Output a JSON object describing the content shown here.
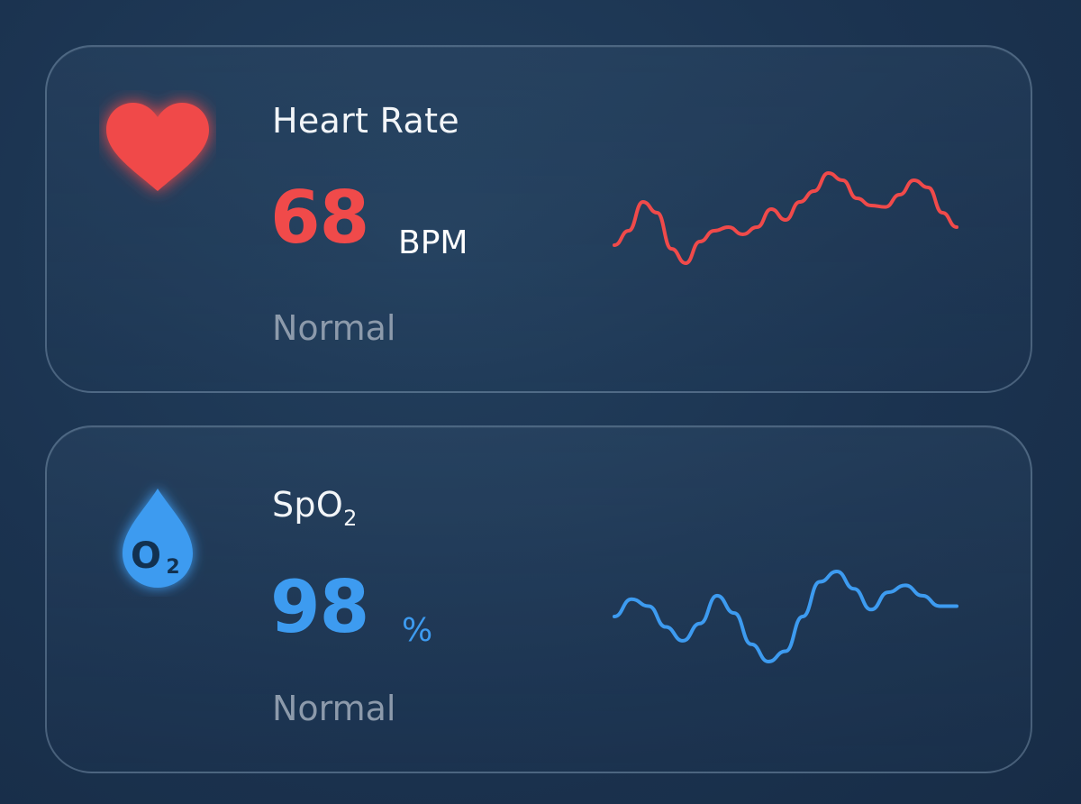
{
  "colors": {
    "heart_accent": "#f04a4a",
    "spo2_accent": "#3d9bf0",
    "status_text": "#8c9aab",
    "title_text": "#f2f5f8"
  },
  "metrics": [
    {
      "id": "heart",
      "icon": "heart-icon",
      "title": "Heart Rate",
      "value": "68",
      "unit": "BPM",
      "status": "Normal",
      "trend": [
        0.35,
        0.55,
        0.95,
        0.8,
        0.3,
        0.1,
        0.4,
        0.55,
        0.6,
        0.5,
        0.6,
        0.85,
        0.7,
        0.95,
        1.1,
        1.35,
        1.25,
        1.0,
        0.9,
        0.88,
        1.05,
        1.25,
        1.15,
        0.8,
        0.6
      ]
    },
    {
      "id": "spo2",
      "icon": "oxygen-drop-icon",
      "title_main": "SpO",
      "title_sub": "2",
      "icon_label_main": "O",
      "icon_label_sub": "2",
      "value": "98",
      "unit": "%",
      "status": "Normal",
      "trend": [
        0.55,
        0.8,
        0.7,
        0.4,
        0.2,
        0.45,
        0.85,
        0.6,
        0.15,
        -0.1,
        0.05,
        0.55,
        1.05,
        1.2,
        0.95,
        0.65,
        0.9,
        1.0,
        0.85,
        0.7,
        0.7
      ]
    }
  ]
}
